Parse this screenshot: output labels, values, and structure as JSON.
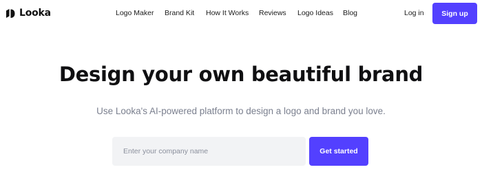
{
  "header": {
    "brand": "Looka",
    "nav": [
      {
        "label": "Logo Maker"
      },
      {
        "label": "Brand Kit"
      },
      {
        "label": "How It Works"
      },
      {
        "label": "Reviews"
      },
      {
        "label": "Logo Ideas"
      },
      {
        "label": "Blog"
      }
    ],
    "login_label": "Log in",
    "signup_label": "Sign up"
  },
  "hero": {
    "headline": "Design your own beautiful brand",
    "subheadline": "Use Looka's AI-powered platform to design a logo and brand you love.",
    "company_input": {
      "value": "",
      "placeholder": "Enter your company name"
    },
    "cta_label": "Get started"
  },
  "colors": {
    "accent": "#5340ff",
    "text": "#111111",
    "muted": "#7a7f8e",
    "input_bg": "#f2f3f5"
  }
}
